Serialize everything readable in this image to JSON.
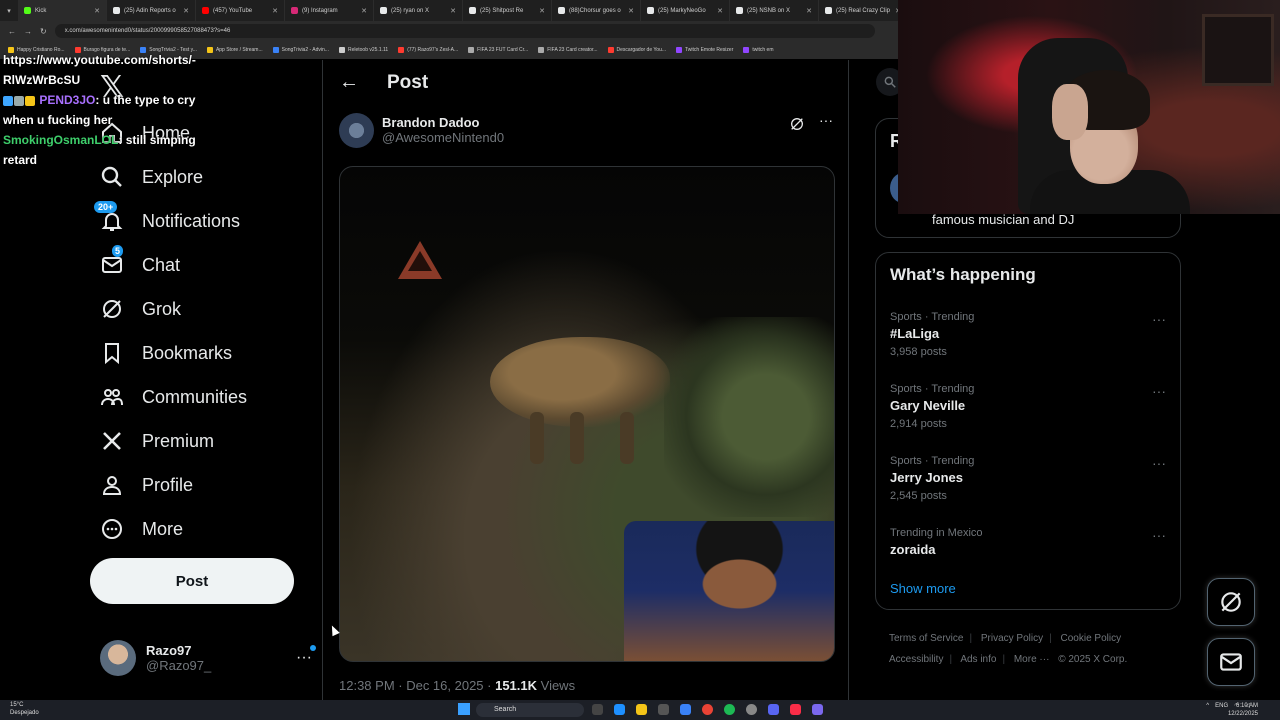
{
  "browser": {
    "tabs": [
      {
        "label": "Kick",
        "color": "#53fc18"
      },
      {
        "label": "(25) Adin Reports o",
        "color": "#e7e9ea"
      },
      {
        "label": "(457) YouTube",
        "color": "#ff0000"
      },
      {
        "label": "(9) Instagram",
        "color": "#d62976"
      },
      {
        "label": "(25) ryan on X",
        "color": "#e7e9ea"
      },
      {
        "label": "(25) Shitpost Re",
        "color": "#e7e9ea"
      },
      {
        "label": "(88)Chorsur goes o",
        "color": "#e7e9ea"
      },
      {
        "label": "(25) MarkyNeoGo",
        "color": "#e7e9ea"
      },
      {
        "label": "(25) NSNB on X",
        "color": "#e7e9ea"
      },
      {
        "label": "(25) Real Crazy Clip",
        "color": "#e7e9ea"
      }
    ],
    "url": "x.com/awesomenintend0/status/2000999058527088473?s=46",
    "bookmarks": [
      {
        "label": "Happy Cristiano Ro...",
        "color": "#f5c518"
      },
      {
        "label": "Burago figura de te...",
        "color": "#ff3b30"
      },
      {
        "label": "SongTrivia2 - Test y...",
        "color": "#3a82f7"
      },
      {
        "label": "App Store / Stream...",
        "color": "#f5c518"
      },
      {
        "label": "SongTrivia2 - Advin...",
        "color": "#3a82f7"
      },
      {
        "label": "Reletoob v25.1.11",
        "color": "#cccccc"
      },
      {
        "label": "(77) Razo97's Zesl-A...",
        "color": "#ff3b30"
      },
      {
        "label": "FIFA 23 FUT Card Cr...",
        "color": "#aaaaaa"
      },
      {
        "label": "FIFA 23 Card creator...",
        "color": "#aaaaaa"
      },
      {
        "label": "Descargador de You...",
        "color": "#ff3b30"
      },
      {
        "label": "Twitch Emote Resizer",
        "color": "#9146ff"
      },
      {
        "label": "twitch em",
        "color": "#9146ff"
      }
    ]
  },
  "chat": {
    "line0": "https://www.youtube.com/shorts/-",
    "line0b": "RlWzWrBcSU",
    "user1": "PEND3JO",
    "msg1a": ": u the type to cry",
    "msg1b": "when u fucking her",
    "user2": "SmokingOsmanLOL",
    "msg2a": ": still simping",
    "msg2b": "retard"
  },
  "nav": {
    "logo": "𝕏",
    "items": [
      {
        "label": "Home",
        "icon": "home-icon"
      },
      {
        "label": "Explore",
        "icon": "search-icon"
      },
      {
        "label": "Notifications",
        "icon": "bell-icon",
        "badge": "20+"
      },
      {
        "label": "Chat",
        "icon": "mail-icon",
        "badge": "5"
      },
      {
        "label": "Grok",
        "icon": "grok-icon"
      },
      {
        "label": "Bookmarks",
        "icon": "bookmark-icon"
      },
      {
        "label": "Communities",
        "icon": "people-icon"
      },
      {
        "label": "Premium",
        "icon": "x-icon"
      },
      {
        "label": "Profile",
        "icon": "person-icon"
      },
      {
        "label": "More",
        "icon": "more-circle-icon"
      }
    ],
    "post_label": "Post",
    "account": {
      "name": "Razo97",
      "handle": "@Razo97_"
    }
  },
  "main": {
    "title": "Post",
    "author_name": "Brandon Dadoo",
    "author_handle": "@AwesomeNintend0",
    "time": "12:38 PM · Dec 16, 2025 · ",
    "views_count": "151.1K",
    "views_label": " Views"
  },
  "right": {
    "card_top_initial": "R",
    "card_top_desc": "famous musician and DJ",
    "happening_title": "What’s happening",
    "trends": [
      {
        "category": "Sports · Trending",
        "name": "#LaLiga",
        "count": "3,958 posts"
      },
      {
        "category": "Sports · Trending",
        "name": "Gary Neville",
        "count": "2,914 posts"
      },
      {
        "category": "Sports · Trending",
        "name": "Jerry Jones",
        "count": "2,545 posts"
      },
      {
        "category": "Trending in Mexico",
        "name": "zoraida",
        "count": ""
      }
    ],
    "show_more": "Show more",
    "footer": {
      "terms": "Terms of Service",
      "privacy": "Privacy Policy",
      "cookie": "Cookie Policy",
      "accessibility": "Accessibility",
      "ads": "Ads info",
      "more": "More ···",
      "copyright": "© 2025 X Corp."
    }
  },
  "taskbar": {
    "temp": "15°C",
    "weather": "Despejado",
    "search": "Search",
    "lang": "ENG",
    "time": "6:10 AM",
    "date": "12/22/2025"
  },
  "colors": {
    "accent": "#1d9bf0",
    "bg": "#000000",
    "border": "#2f3336",
    "muted": "#71767b"
  }
}
